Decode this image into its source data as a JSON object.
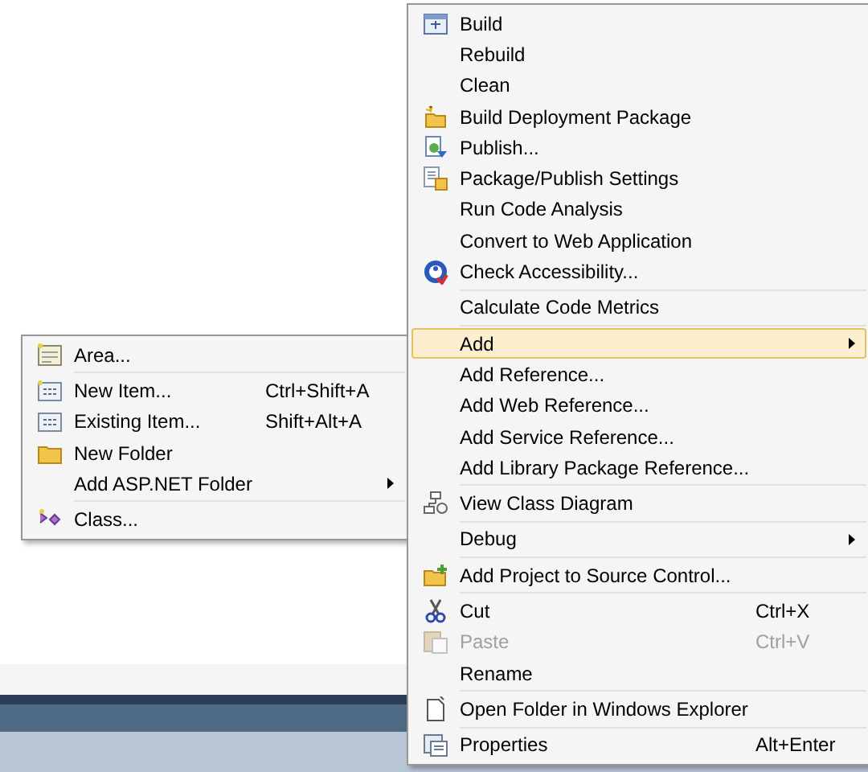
{
  "context_menu": {
    "items": [
      {
        "kind": "item",
        "label": "Build"
      },
      {
        "kind": "item",
        "label": "Rebuild"
      },
      {
        "kind": "item",
        "label": "Clean"
      },
      {
        "kind": "item",
        "label": "Build Deployment Package"
      },
      {
        "kind": "item",
        "label": "Publish..."
      },
      {
        "kind": "item",
        "label": "Package/Publish Settings"
      },
      {
        "kind": "item",
        "label": "Run Code Analysis"
      },
      {
        "kind": "item",
        "label": "Convert to Web Application"
      },
      {
        "kind": "item",
        "label": "Check Accessibility..."
      },
      {
        "kind": "separator"
      },
      {
        "kind": "item",
        "label": "Calculate Code Metrics"
      },
      {
        "kind": "separator"
      },
      {
        "kind": "item",
        "label": "Add",
        "submenu": true,
        "selected": true
      },
      {
        "kind": "item",
        "label": "Add Reference..."
      },
      {
        "kind": "item",
        "label": "Add Web Reference..."
      },
      {
        "kind": "item",
        "label": "Add Service Reference..."
      },
      {
        "kind": "item",
        "label": "Add Library Package Reference..."
      },
      {
        "kind": "separator"
      },
      {
        "kind": "item",
        "label": "View Class Diagram"
      },
      {
        "kind": "separator"
      },
      {
        "kind": "item",
        "label": "Debug",
        "submenu": true
      },
      {
        "kind": "separator"
      },
      {
        "kind": "item",
        "label": "Add Project to Source Control..."
      },
      {
        "kind": "separator"
      },
      {
        "kind": "item",
        "label": "Cut",
        "shortcut": "Ctrl+X"
      },
      {
        "kind": "item",
        "label": "Paste",
        "shortcut": "Ctrl+V",
        "disabled": true
      },
      {
        "kind": "item",
        "label": "Rename"
      },
      {
        "kind": "separator"
      },
      {
        "kind": "item",
        "label": "Open Folder in Windows Explorer"
      },
      {
        "kind": "separator"
      },
      {
        "kind": "item",
        "label": "Properties",
        "shortcut": "Alt+Enter"
      }
    ]
  },
  "add_submenu": {
    "items": [
      {
        "kind": "item",
        "label": "Area..."
      },
      {
        "kind": "separator"
      },
      {
        "kind": "item",
        "label": "New Item...",
        "shortcut": "Ctrl+Shift+A"
      },
      {
        "kind": "item",
        "label": "Existing Item...",
        "shortcut": "Shift+Alt+A"
      },
      {
        "kind": "item",
        "label": "New Folder"
      },
      {
        "kind": "item",
        "label": "Add ASP.NET Folder",
        "submenu": true
      },
      {
        "kind": "separator"
      },
      {
        "kind": "item",
        "label": "Class..."
      }
    ]
  }
}
